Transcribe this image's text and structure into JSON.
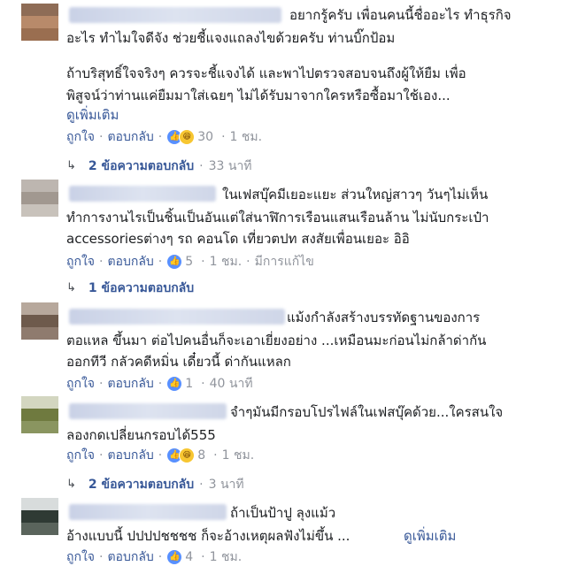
{
  "comments": [
    {
      "lines": [
        "อยากรู้ครับ เพื่อนคนนี้ชื่ออะไร ทำธุรกิจ",
        "อะไร ทำไมใจดีจัง ช่วยชี้แจงแถลงไขด้วยครับ ท่านบิ๊กป้อม",
        "",
        "ถ้าบริสุทธิ์ใจจริงๆ ควรจะชี้แจงได้ และพาไปตรวจสอบจนถึงผู้ให้ยืม เพื่อ",
        "พิสูจน์ว่าท่านแค่ยืมมาใส่เฉยๆ ไม่ได้รับมาจากใครหรือซื้อมาใช้เอง..."
      ],
      "see_more": "ดูเพิ่มเติม",
      "like": "ถูกใจ",
      "reply": "ตอบกลับ",
      "reaction_count": "30",
      "time": "1 ชม.",
      "replies_label": "2 ข้อความตอบกลับ",
      "replies_time": "33 นาที"
    },
    {
      "lines": [
        "ในเฟสบุ๊คมีเยอะแยะ ส่วนใหญ่สาวๆ วันๆไม่เห็น",
        "ทำการงานไรเป็นชิ้นเป็นอันแต่ใส่นาฬิการเรือนแสนเรือนล้าน ไม่นับกระเป๋า",
        "accessoriesต่างๆ รถ คอนโด เที่ยวตปท สงสัยเพื่อนเยอะ อิอิ"
      ],
      "like": "ถูกใจ",
      "reply": "ตอบกลับ",
      "reaction_count": "5",
      "time": "1 ชม.",
      "edited": "มีการแก้ไข",
      "replies_label": "1 ข้อความตอบกลับ"
    },
    {
      "lines": [
        "แม้งกำลังสร้างบรรทัดฐานของการ",
        "ตอแหล ขึ้นมา ต่อไปคนอื่นก็จะเอาเยี่ยงอย่าง ...เหมือนมะก่อนไม่กล้าด่ากัน",
        "ออกทีวี กลัวคดีหมิ่น เดี๋ยวนี้ ด่ากันแหลก"
      ],
      "like": "ถูกใจ",
      "reply": "ตอบกลับ",
      "reaction_count": "1",
      "time": "40 นาที"
    },
    {
      "lines": [
        "จำๆมันมีกรอบโปรไฟล์ในเฟสบุ๊คด้วย...ใครสนใจ",
        "ลองกดเปลี่ยนกรอบได้555"
      ],
      "like": "ถูกใจ",
      "reply": "ตอบกลับ",
      "reaction_count": "8",
      "time": "1 ชม.",
      "replies_label": "2 ข้อความตอบกลับ",
      "replies_time": "3 นาที"
    },
    {
      "lines": [
        "ถ้าเป็นป้าปู ลุงแม้ว",
        "อ้างแบบนี้ ปปปปชชชช ก็จะอ้างเหตุผลฟังไม่ขึ้น ..."
      ],
      "see_more": "ดูเพิ่มเติม",
      "like": "ถูกใจ",
      "reply": "ตอบกลับ",
      "reaction_count": "4",
      "time": "1 ชม."
    }
  ],
  "icons": {
    "like": "like-icon",
    "haha": "haha-icon",
    "reply_arrow": "reply-arrow-icon"
  },
  "colors": {
    "link": "#385898",
    "meta": "#90949c",
    "like": "#5890ff",
    "haha": "#f7c631"
  }
}
